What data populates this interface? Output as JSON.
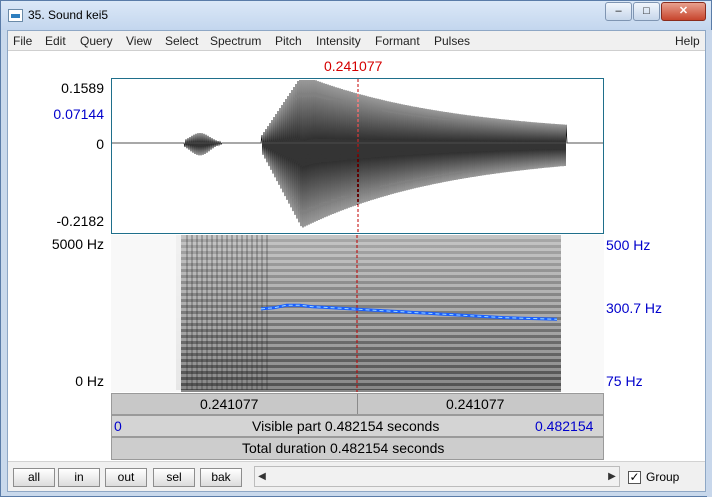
{
  "window": {
    "title": "35. Sound kei5",
    "controls": {
      "minimize": "–",
      "maximize": "□",
      "close": "✕"
    }
  },
  "menu": [
    "File",
    "Edit",
    "Query",
    "View",
    "Select",
    "Spectrum",
    "Pitch",
    "Intensity",
    "Formant",
    "Pulses",
    "Help"
  ],
  "cursor": {
    "time": "0.241077"
  },
  "waveform": {
    "max": "0.1589",
    "cursor_value": "0.07144",
    "zero": "0",
    "min": "-0.2182"
  },
  "spectrogram": {
    "freq_max": "5000 Hz",
    "freq_min": "0 Hz"
  },
  "pitch": {
    "top": "500 Hz",
    "current": "300.7 Hz",
    "bottom": "75 Hz",
    "contour_hz": [
      300,
      303,
      310,
      310,
      306,
      304,
      302,
      300,
      298,
      296,
      294,
      292,
      290,
      288,
      286,
      284,
      282,
      280,
      278,
      276,
      275,
      274,
      273,
      272
    ]
  },
  "time_bar": {
    "left": "0.241077",
    "right": "0.241077",
    "visible_label": "Visible part 0.482154 seconds",
    "visible_start": "0",
    "visible_end": "0.482154",
    "total_label": "Total duration 0.482154 seconds"
  },
  "buttons": [
    "all",
    "in",
    "out",
    "sel",
    "bak"
  ],
  "group": {
    "label": "Group",
    "checked": true
  }
}
